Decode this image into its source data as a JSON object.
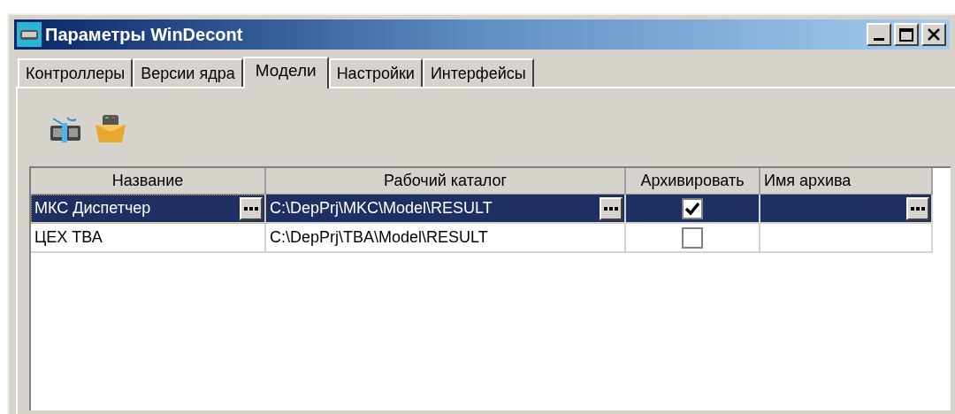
{
  "window": {
    "title": "Параметры WinDecont"
  },
  "tabs": [
    {
      "label": "Контроллеры",
      "selected": false
    },
    {
      "label": "Версии ядра",
      "selected": false
    },
    {
      "label": "Модели",
      "selected": true
    },
    {
      "label": "Настройки",
      "selected": false
    },
    {
      "label": "Интерфейсы",
      "selected": false
    }
  ],
  "table": {
    "columns": [
      "Название",
      "Рабочий каталог",
      "Архивировать",
      "Имя архива"
    ],
    "rows": [
      {
        "name": "МКС Диспетчер",
        "directory": "C:\\DepPrj\\MKC\\Model\\RESULT",
        "archive": true,
        "selected": true
      },
      {
        "name": "ЦЕХ ТВА",
        "directory": "C:\\DepPrj\\TBA\\Model\\RESULT",
        "archive": false,
        "selected": false
      }
    ]
  }
}
